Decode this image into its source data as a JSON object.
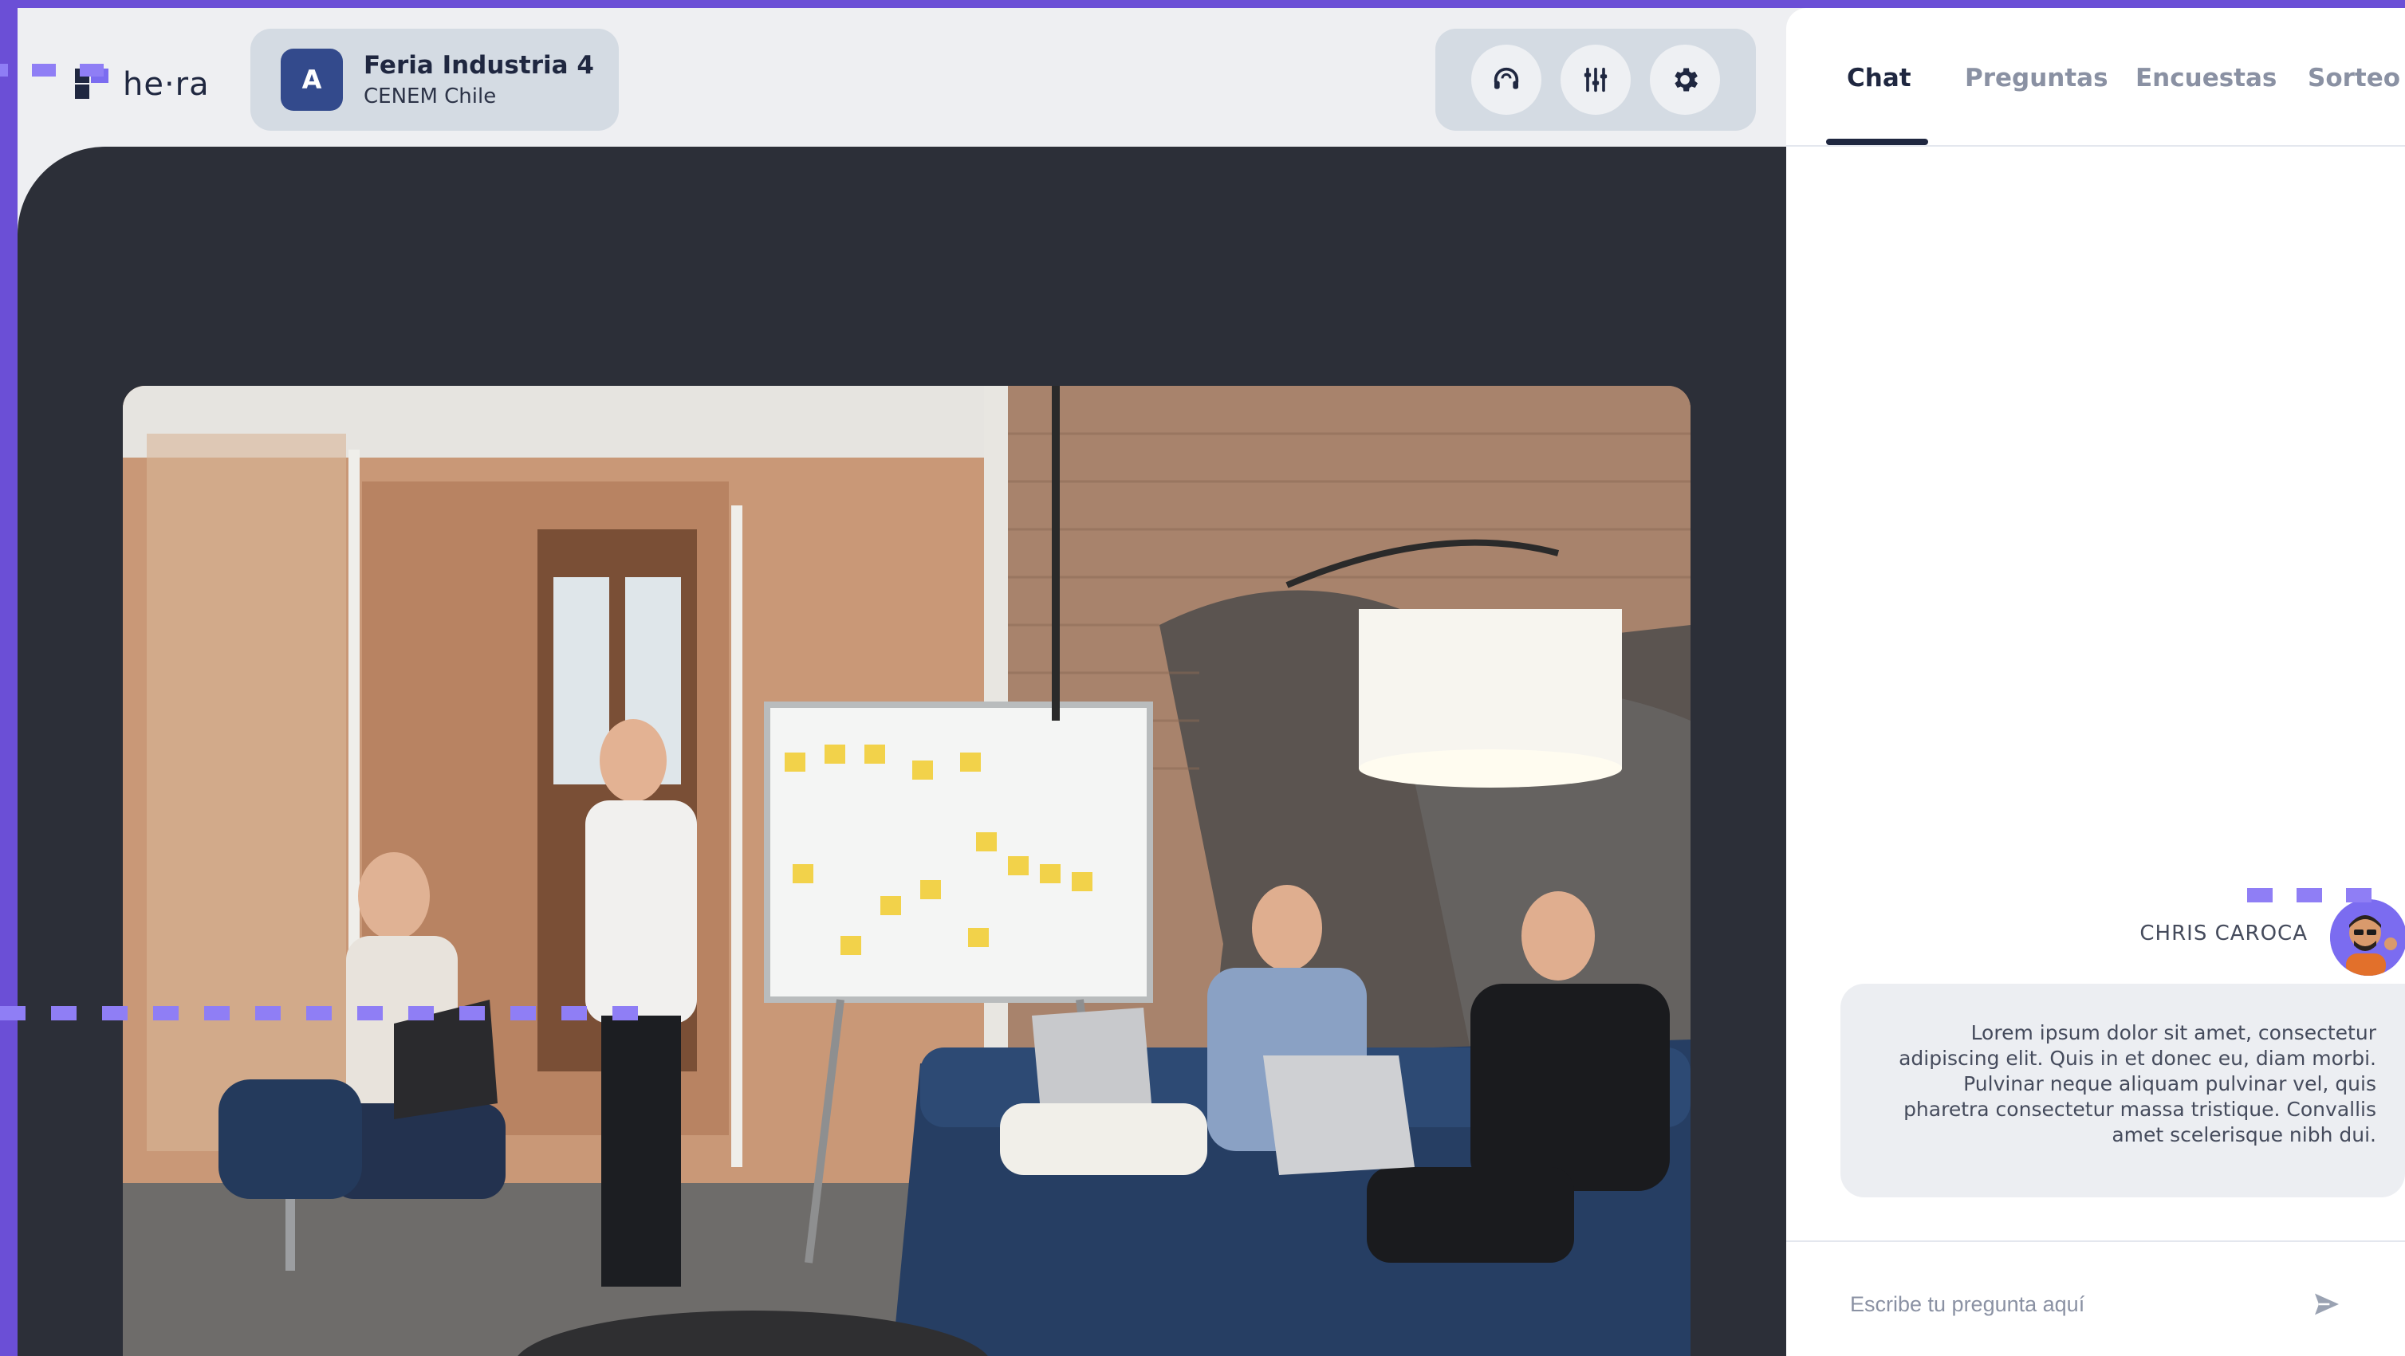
{
  "app": {
    "logo_text": "he·ra"
  },
  "event": {
    "avatar_letter": "A",
    "title": "Feria Industria 4",
    "subtitle": "CENEM Chile"
  },
  "toolbar": {
    "icons": [
      "headset-icon",
      "equalizer-icon",
      "gear-icon"
    ]
  },
  "tabs": [
    {
      "label": "Chat",
      "active": true
    },
    {
      "label": "Preguntas",
      "active": false
    },
    {
      "label": "Encuestas",
      "active": false
    },
    {
      "label": "Sorteo",
      "active": false
    }
  ],
  "chat": {
    "messages": [
      {
        "author": "CHRIS CAROCA",
        "text": "Lorem ipsum dolor sit amet, consectetur adipiscing elit. Quis in et donec eu, diam morbi. Pulvinar neque aliquam pulvinar vel, quis pharetra consectetur massa tristique. Convallis amet scelerisque nibh dui."
      }
    ],
    "input_placeholder": "Escribe tu pregunta aquí"
  },
  "colors": {
    "accent": "#6b4fd6",
    "navy": "#1f2740",
    "stage": "#2c2f38",
    "card": "#d4dbe3"
  }
}
